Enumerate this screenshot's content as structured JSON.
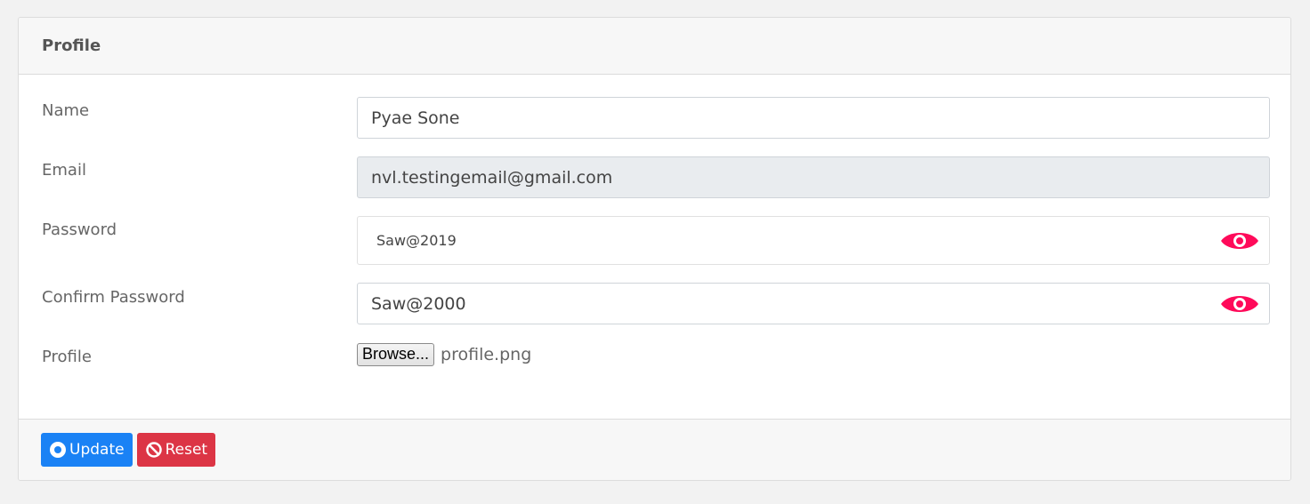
{
  "card": {
    "title": "Profile"
  },
  "form": {
    "name": {
      "label": "Name",
      "value": "Pyae Sone"
    },
    "email": {
      "label": "Email",
      "value": "nvl.testingemail@gmail.com"
    },
    "password": {
      "label": "Password",
      "value": "Saw@2019",
      "toggle_icon": "eye-icon"
    },
    "confirm_password": {
      "label": "Confirm Password",
      "value": "Saw@2000",
      "toggle_icon": "eye-icon"
    },
    "profile": {
      "label": "Profile",
      "browse_label": "Browse...",
      "file_name": "profile.png"
    }
  },
  "footer": {
    "update_label": "Update",
    "update_icon": "dot-circle-icon",
    "reset_label": "Reset",
    "reset_icon": "ban-icon"
  },
  "colors": {
    "primary": "#1a82f5",
    "danger": "#dc3545",
    "eye_icon": "#ff0a5a"
  }
}
